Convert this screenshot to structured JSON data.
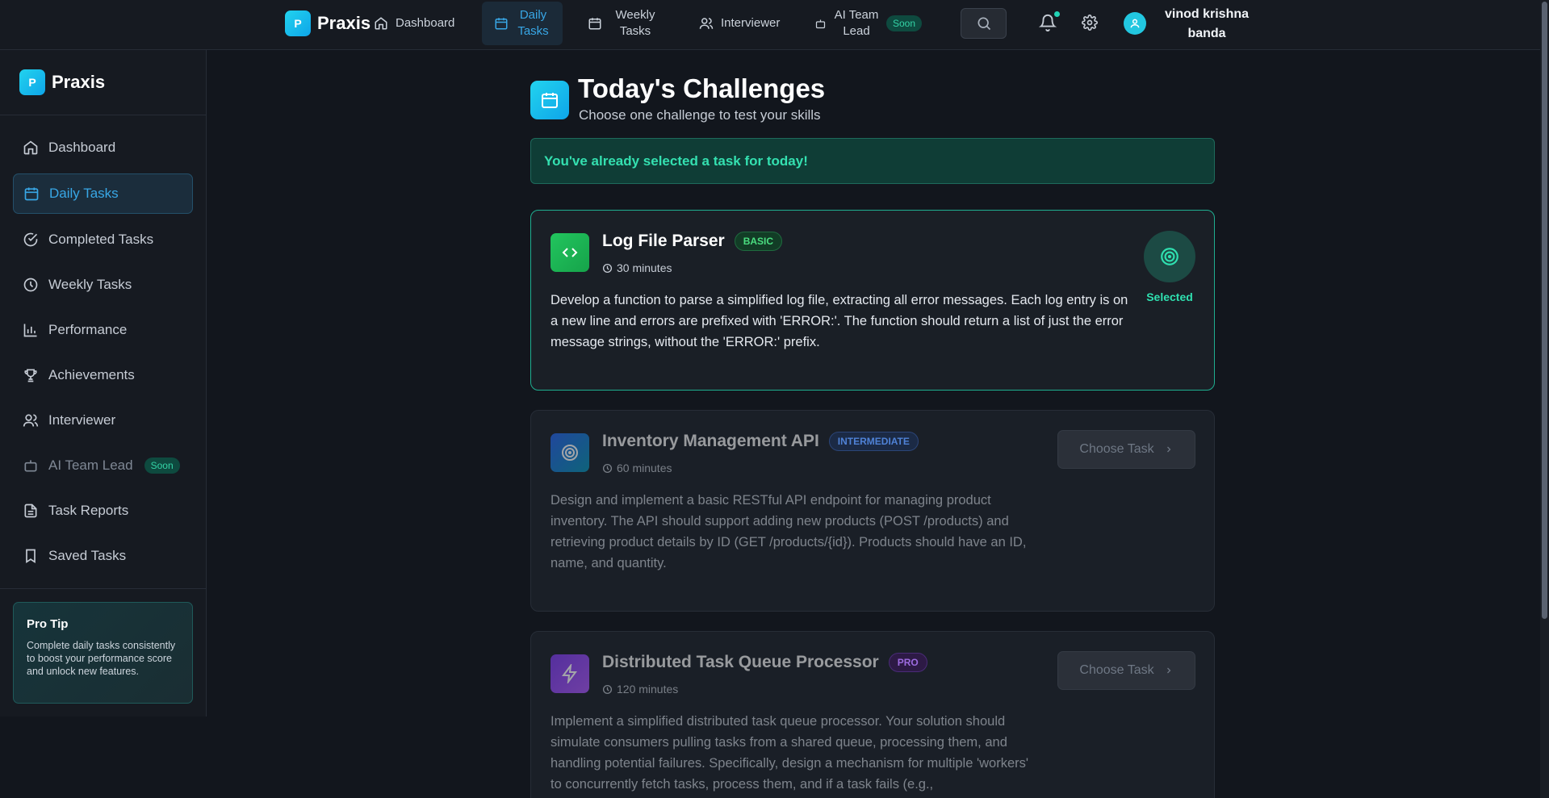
{
  "app": {
    "name": "Praxis",
    "logo_letter": "P"
  },
  "topnav": {
    "items": [
      {
        "label": "Dashboard"
      },
      {
        "label": "Daily Tasks"
      },
      {
        "label": "Weekly Tasks"
      },
      {
        "label": "Interviewer"
      },
      {
        "label": "AI Team Lead"
      }
    ],
    "soon_badge": "Soon",
    "user_name": "vinod krishna banda"
  },
  "sidebar": {
    "items": [
      {
        "label": "Dashboard",
        "icon": "home-icon"
      },
      {
        "label": "Daily Tasks",
        "icon": "calendar-icon",
        "active": true
      },
      {
        "label": "Completed Tasks",
        "icon": "check-circle-icon"
      },
      {
        "label": "Weekly Tasks",
        "icon": "clock-icon"
      },
      {
        "label": "Performance",
        "icon": "bar-chart-icon"
      },
      {
        "label": "Achievements",
        "icon": "trophy-icon"
      },
      {
        "label": "Interviewer",
        "icon": "users-icon"
      },
      {
        "label": "AI Team Lead",
        "icon": "bot-icon",
        "badge": "Soon"
      },
      {
        "label": "Task Reports",
        "icon": "file-text-icon"
      },
      {
        "label": "Saved Tasks",
        "icon": "bookmark-icon"
      }
    ],
    "pro_tip": {
      "title": "Pro Tip",
      "text": "Complete daily tasks consistently to boost your performance score and unlock new features."
    }
  },
  "main": {
    "title": "Today's Challenges",
    "subtitle": "Choose one challenge to test your skills",
    "notice": "You've already selected a task for today!",
    "tasks": [
      {
        "title": "Log File Parser",
        "level": "BASIC",
        "duration": "30 minutes",
        "description": "Develop a function to parse a simplified log file, extracting all error messages. Each log entry is on a new line and errors are prefixed with 'ERROR:'. The function should return a list of just the error message strings, without the 'ERROR:' prefix.",
        "status": "Selected",
        "icon": "code-icon"
      },
      {
        "title": "Inventory Management API",
        "level": "INTERMEDIATE",
        "duration": "60 minutes",
        "description": "Design and implement a basic RESTful API endpoint for managing product inventory. The API should support adding new products (POST /products) and retrieving product details by ID (GET /products/{id}). Products should have an ID, name, and quantity.",
        "button": "Choose Task",
        "icon": "target-icon"
      },
      {
        "title": "Distributed Task Queue Processor",
        "level": "PRO",
        "duration": "120 minutes",
        "description": "Implement a simplified distributed task queue processor. Your solution should simulate consumers pulling tasks from a shared queue, processing them, and handling potential failures. Specifically, design a mechanism for multiple 'workers' to concurrently fetch tasks, process them, and if a task fails (e.g.,",
        "button": "Choose Task",
        "icon": "zap-icon"
      }
    ]
  },
  "colors": {
    "accent": "#38a7e6",
    "success": "#2fe0b0",
    "basic_badge": "#4ade80",
    "intermediate_badge": "#3b82f6",
    "pro_badge": "#a855f7"
  }
}
